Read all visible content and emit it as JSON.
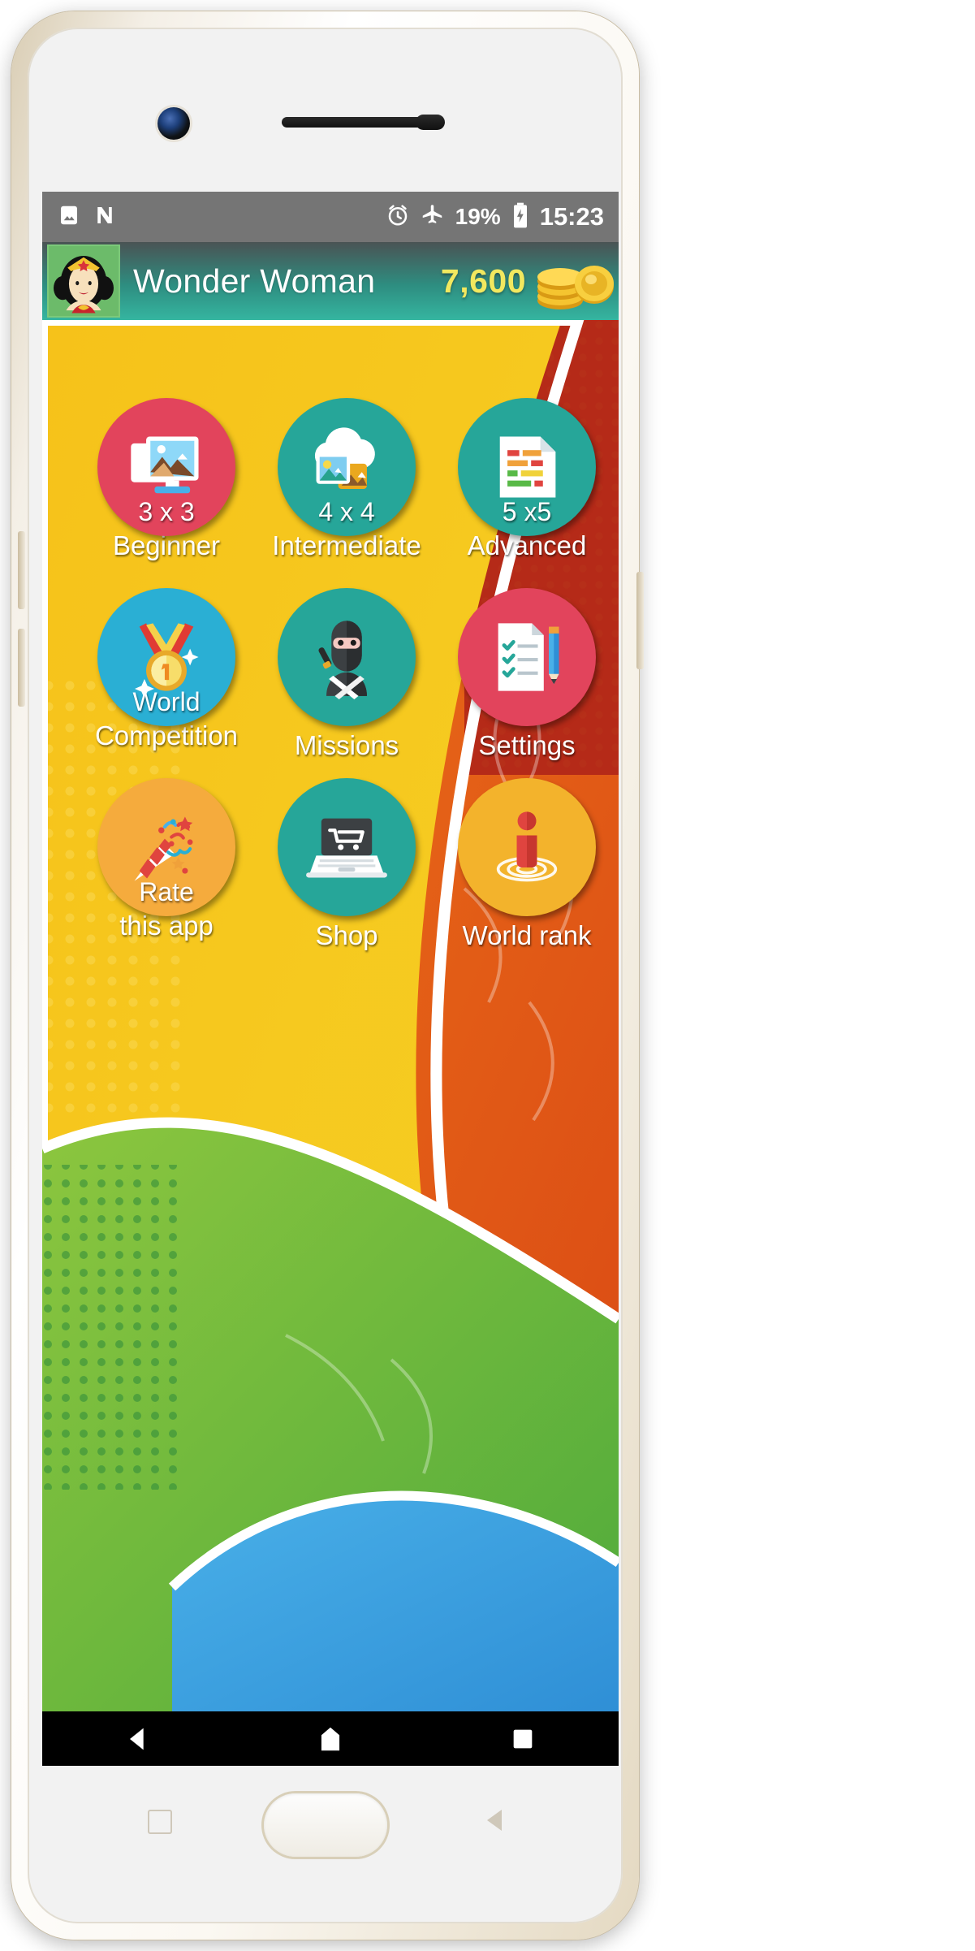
{
  "status_bar": {
    "icons_left": [
      "image-icon",
      "n-logo-icon"
    ],
    "alarm_icon": "alarm-icon",
    "airplane_icon": "airplane-mode-icon",
    "battery_percent": "19%",
    "battery_icon": "battery-charging-icon",
    "clock": "15:23",
    "background_color": "#757575"
  },
  "app_header": {
    "avatar_name": "wonder-woman-avatar",
    "player_name": "Wonder Woman",
    "coins": "7,600",
    "coins_color": "#f2e85f",
    "coin_icon": "coin-stack-icon",
    "background_color": "#35b5a0"
  },
  "tiles": [
    {
      "sub": "3 x 3",
      "label": "Beginner",
      "icon": "photo-gallery-icon",
      "color": "#e2445c",
      "name": "tile-beginner"
    },
    {
      "sub": "4 x 4",
      "label": "Intermediate",
      "icon": "cloud-photos-icon",
      "color": "#26a699",
      "name": "tile-intermediate"
    },
    {
      "sub": "5 x5",
      "label": "Advanced",
      "icon": "equalizer-icon",
      "color": "#26a699",
      "name": "tile-advanced"
    },
    {
      "sub": "World",
      "label": "Competition",
      "icon": "medal-first-place-icon",
      "color": "#2aafd4",
      "name": "tile-world-competition"
    },
    {
      "sub": "",
      "label": "Missions",
      "icon": "ninja-icon",
      "color": "#26a699",
      "name": "tile-missions"
    },
    {
      "sub": "",
      "label": "Settings",
      "icon": "checklist-pencil-icon",
      "color": "#e2445c",
      "name": "tile-settings"
    },
    {
      "sub": "Rate",
      "label": "this app",
      "icon": "party-popper-icon",
      "color": "#f5ab3d",
      "name": "tile-rate-this-app"
    },
    {
      "sub": "",
      "label": "Shop",
      "icon": "laptop-cart-icon",
      "color": "#26a699",
      "name": "tile-shop"
    },
    {
      "sub": "",
      "label": "World rank",
      "icon": "person-target-icon",
      "color": "#f3b32c",
      "name": "tile-world-rank"
    }
  ],
  "nav_bar": {
    "back": "back-triangle-icon",
    "home": "home-pentagon-icon",
    "recents": "recents-square-icon",
    "background_color": "#000000"
  }
}
